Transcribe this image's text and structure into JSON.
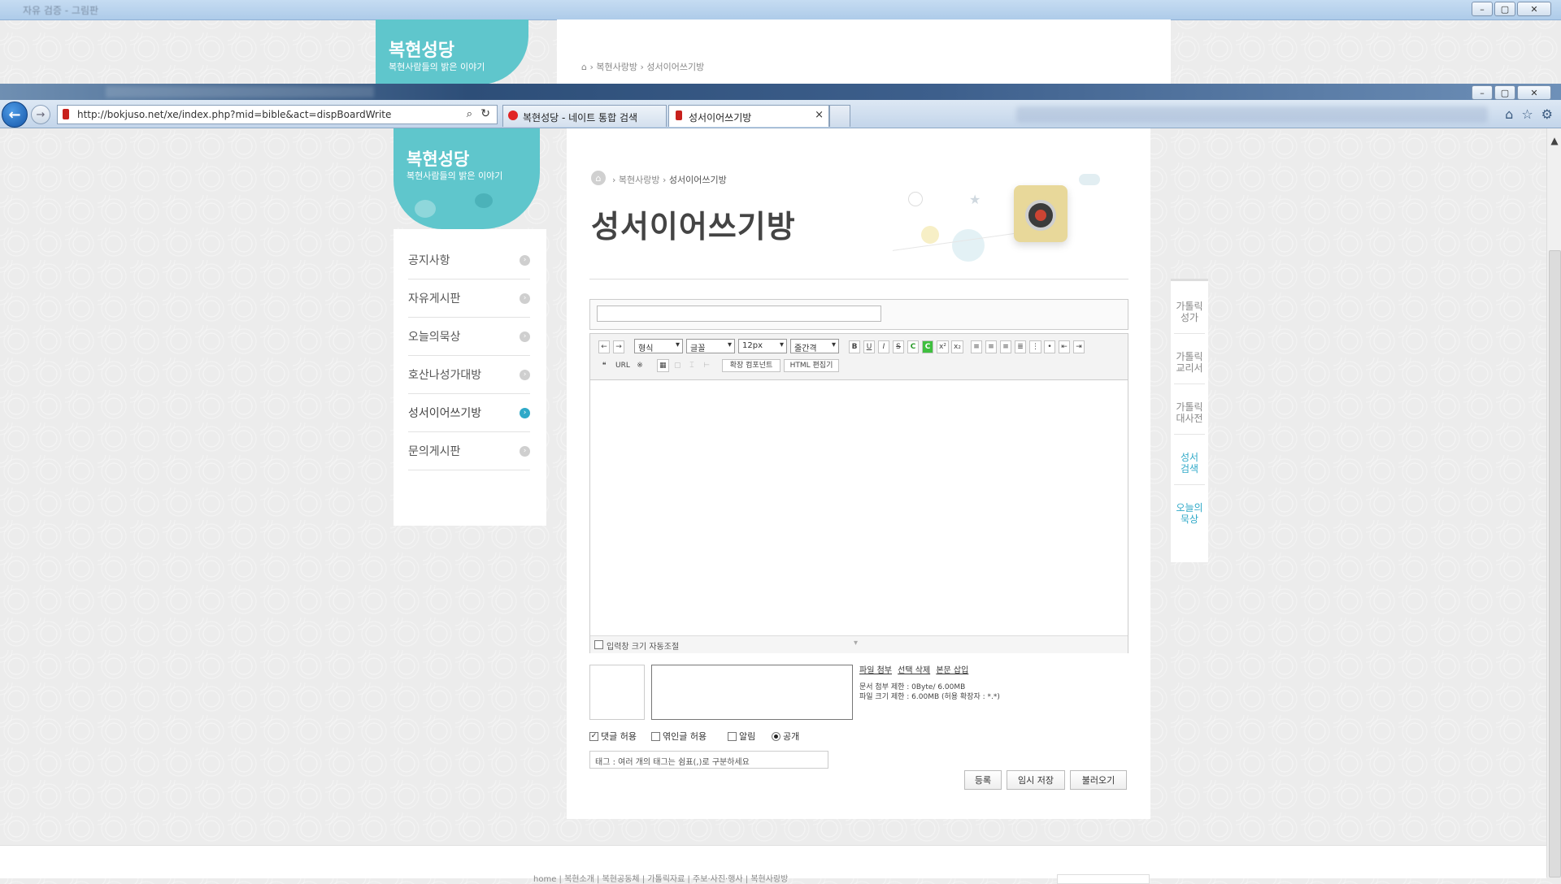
{
  "bg_window": {
    "title_blurred": "자유 검증 - 그림판",
    "logo_title": "복현성당",
    "logo_subtitle": "복현사람들의 밝은 이야기",
    "breadcrumb": [
      "복현사랑방",
      "성서이어쓰기방"
    ]
  },
  "window_controls": {
    "minimize": "–",
    "maximize": "▢",
    "close": "✕"
  },
  "browser": {
    "back_icon": "arrow-left-icon",
    "forward_icon": "arrow-right-icon",
    "address_url": "http://bokjuso.net/xe/index.php?mid=bible&act=dispBoardWrite",
    "search_glyph": "⌕",
    "refresh_glyph": "↻",
    "tabs": [
      {
        "label": "복현성당 - 네이트 통합 검색",
        "active": false
      },
      {
        "label": "성서이어쓰기방",
        "active": true,
        "close": "×"
      }
    ],
    "toolbar_right_icons": [
      "⌂",
      "☆",
      "⚙"
    ]
  },
  "site": {
    "logo_title": "복현성당",
    "logo_subtitle": "복현사람들의 밝은 이야기",
    "menu": [
      {
        "label": "공지사항",
        "active": false
      },
      {
        "label": "자유게시판",
        "active": false
      },
      {
        "label": "오늘의묵상",
        "active": false
      },
      {
        "label": "호산나성가대방",
        "active": false
      },
      {
        "label": "성서이어쓰기방",
        "active": true
      },
      {
        "label": "문의게시판",
        "active": false
      }
    ],
    "menu_arrow": "›"
  },
  "content": {
    "home_glyph": "⌂",
    "breadcrumb_parent": "복현사랑방",
    "breadcrumb_current": "성서이어쓰기방",
    "breadcrumb_sep": "›",
    "page_title": "성서이어쓰기방",
    "title_input_value": ""
  },
  "editor": {
    "undo": "←",
    "redo": "→",
    "format_select": "형식",
    "font_select": "글꼴",
    "size_select": "12px",
    "lineheight_select": "줄간격",
    "bold": "B",
    "underline": "U",
    "italic": "I",
    "strike": "S",
    "fontcolor": "C",
    "bgcolor": "C",
    "superscript": "x²",
    "subscript": "x₂",
    "quote": "❝",
    "url": "URL",
    "special": "※",
    "extend_component": "확장 컴포넌트",
    "html_editor": "HTML 편집기",
    "auto_resize_label": "입력창 크기 자동조절",
    "resize_handle": "▾"
  },
  "attach": {
    "links": [
      "파일 첨부",
      "선택 삭제",
      "본문 삽입"
    ],
    "info1": "문서 첨부 제한 : 0Byte/ 6.00MB",
    "info2": "파일 크기 제한 : 6.00MB (허용 확장자 : *.*)"
  },
  "options": {
    "allow_comment": {
      "label": "댓글 허용",
      "checked": true
    },
    "allow_trackback": {
      "label": "엮인글 허용",
      "checked": false
    },
    "notify": {
      "label": "알림",
      "checked": false
    },
    "public": {
      "label": "공개",
      "checked": true
    },
    "tag_placeholder": "태그 : 여러 개의 태그는 쉼표(,)로 구분하세요"
  },
  "actions": {
    "submit": "등록",
    "temp_save": "임시 저장",
    "load": "불러오기"
  },
  "right_widget": [
    {
      "label1": "가톨릭",
      "label2": "성가",
      "accent": false
    },
    {
      "label1": "가톨릭",
      "label2": "교리서",
      "accent": false
    },
    {
      "label1": "가톨릭",
      "label2": "대사전",
      "accent": false
    },
    {
      "label1": "성서",
      "label2": "검색",
      "accent": true
    },
    {
      "label1": "오늘의",
      "label2": "묵상",
      "accent": true
    }
  ],
  "scroll_up": "▲",
  "footer_links": "home  |  복현소개  |  복현공동체  |  가톨릭자료  |  주보·사진·행사  |  복현사랑방"
}
